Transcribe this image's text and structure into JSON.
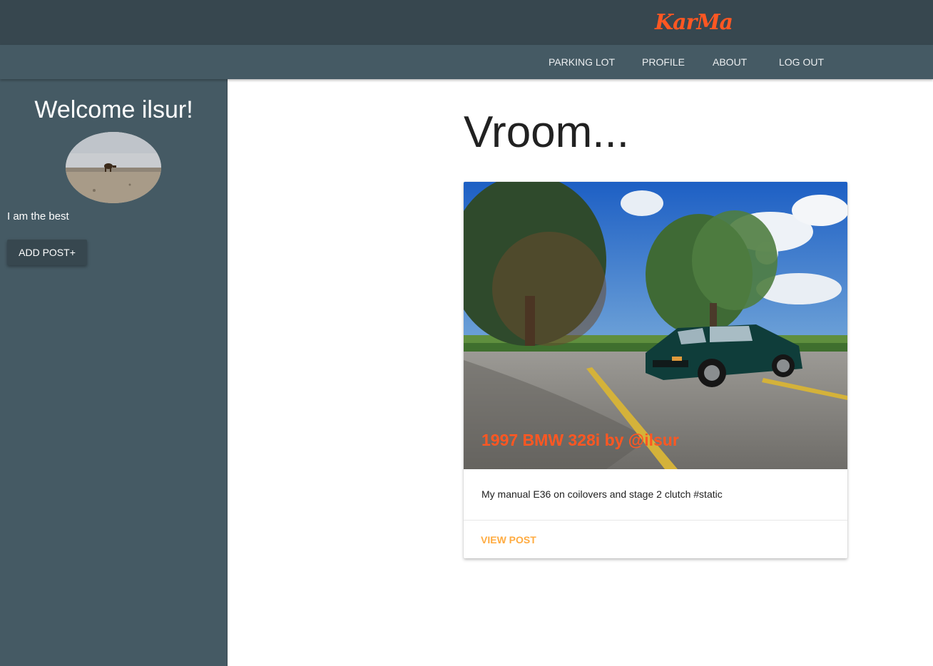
{
  "header": {
    "brand": "KarMa"
  },
  "nav": {
    "items": [
      {
        "label": "PARKING LOT"
      },
      {
        "label": "PROFILE"
      },
      {
        "label": "ABOUT"
      },
      {
        "label": "LOG OUT"
      }
    ]
  },
  "sidebar": {
    "welcome": "Welcome ilsur!",
    "bio": "I am the best",
    "add_post_label": "ADD POST+"
  },
  "main": {
    "title": "Vroom...",
    "post": {
      "title": "1997 BMW 328i by @ilsur",
      "content": "My manual E36 on coilovers and stage 2 clutch #static",
      "action_label": "VIEW POST"
    }
  },
  "colors": {
    "topbar": "#37474f",
    "navbar": "#455a64",
    "accent": "#ff5722",
    "action": "#ffab40"
  }
}
